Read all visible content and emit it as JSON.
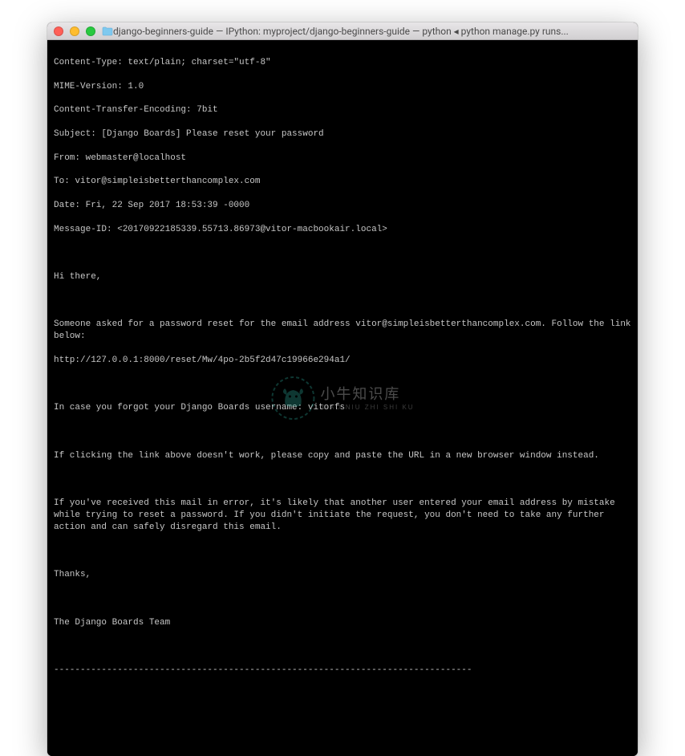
{
  "window": {
    "title": "django-beginners-guide — IPython: myproject/django-beginners-guide — python ◂ python manage.py runs..."
  },
  "terminal": {
    "l1": "Content-Type: text/plain; charset=\"utf-8\"",
    "l2": "MIME-Version: 1.0",
    "l3": "Content-Transfer-Encoding: 7bit",
    "l4": "Subject: [Django Boards] Please reset your password",
    "l5": "From: webmaster@localhost",
    "l6": "To: vitor@simpleisbetterthancomplex.com",
    "l7": "Date: Fri, 22 Sep 2017 18:53:39 -0000",
    "l8": "Message-ID: <20170922185339.55713.86973@vitor-macbookair.local>",
    "blank1": "",
    "l9": "Hi there,",
    "blank2": "",
    "l10": "Someone asked for a password reset for the email address vitor@simpleisbetterthancomplex.com. Follow the link below:",
    "l11": "http://127.0.0.1:8000/reset/Mw/4po-2b5f2d47c19966e294a1/",
    "blank3": "",
    "l12": "In case you forgot your Django Boards username: vitorfs",
    "blank4": "",
    "l13": "If clicking the link above doesn't work, please copy and paste the URL in a new browser window instead.",
    "blank5": "",
    "l14": "If you've received this mail in error, it's likely that another user entered your email address by mistake while trying to reset a password. If you didn't initiate the request, you don't need to take any further action and can safely disregard this email.",
    "blank6": "",
    "l15": "Thanks,",
    "blank7": "",
    "l16": "The Django Boards Team",
    "blank8": "",
    "l17": "-------------------------------------------------------------------------------"
  },
  "watermark": {
    "main": "小牛知识库",
    "sub": "XIAO NIU ZHI SHI KU"
  }
}
